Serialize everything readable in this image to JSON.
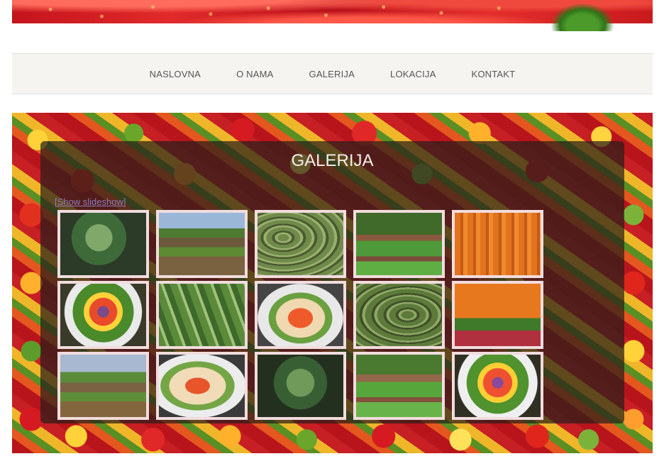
{
  "nav": {
    "items": [
      "NASLOVNA",
      "O NAMA",
      "GALERIJA",
      "LOKACIJA",
      "KONTAKT"
    ]
  },
  "gallery": {
    "title": "GALERIJA",
    "slideshow_link": "[Show slideshow]",
    "thumbnails": [
      "broccoli",
      "field",
      "cucumbers",
      "garden",
      "carrots",
      "vegetable-plate",
      "greens",
      "salad",
      "cucumbers",
      "carrots",
      "field",
      "salad",
      "broccoli",
      "garden",
      "vegetable-plate"
    ]
  },
  "colors": {
    "nav_text": "#555555",
    "panel_bg": "rgba(40,30,25,0.72)",
    "thumb_border": "#f1dcde",
    "link": "#8f7ab8"
  }
}
